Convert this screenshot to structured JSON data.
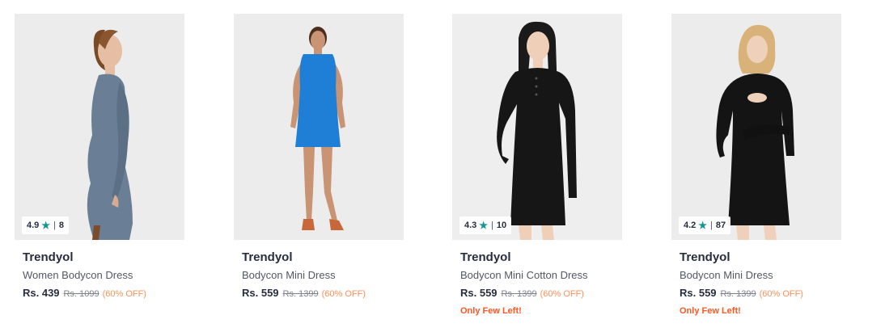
{
  "products": [
    {
      "brand": "Trendyol",
      "name": "Women Bodycon Dress",
      "price": "Rs. 439",
      "mrp": "Rs. 1099",
      "discount": "(60% OFF)",
      "rating": "4.9",
      "rating_count": "8",
      "stock": "",
      "dress_color": "#6a7f96",
      "image": "model-in-grey-blue-long-sleeve-dress"
    },
    {
      "brand": "Trendyol",
      "name": "Bodycon Mini Dress",
      "price": "Rs. 559",
      "mrp": "Rs. 1399",
      "discount": "(60% OFF)",
      "rating": "",
      "rating_count": "",
      "stock": "",
      "dress_color": "#1f7fd6",
      "image": "model-in-blue-sleeveless-dress"
    },
    {
      "brand": "Trendyol",
      "name": "Bodycon Mini Cotton Dress",
      "price": "Rs. 559",
      "mrp": "Rs. 1399",
      "discount": "(60% OFF)",
      "rating": "4.3",
      "rating_count": "10",
      "stock": "Only Few Left!",
      "dress_color": "#141414",
      "image": "model-in-black-henley-dress"
    },
    {
      "brand": "Trendyol",
      "name": "Bodycon Mini Dress",
      "price": "Rs. 559",
      "mrp": "Rs. 1399",
      "discount": "(60% OFF)",
      "rating": "4.2",
      "rating_count": "87",
      "stock": "Only Few Left!",
      "dress_color": "#141414",
      "image": "model-in-black-cutout-dress"
    }
  ],
  "colors": {
    "rating_star": "#14958f",
    "discount": "#ff905a",
    "stock_alert": "#ff5722"
  },
  "icons": {
    "rating": "star-icon"
  }
}
